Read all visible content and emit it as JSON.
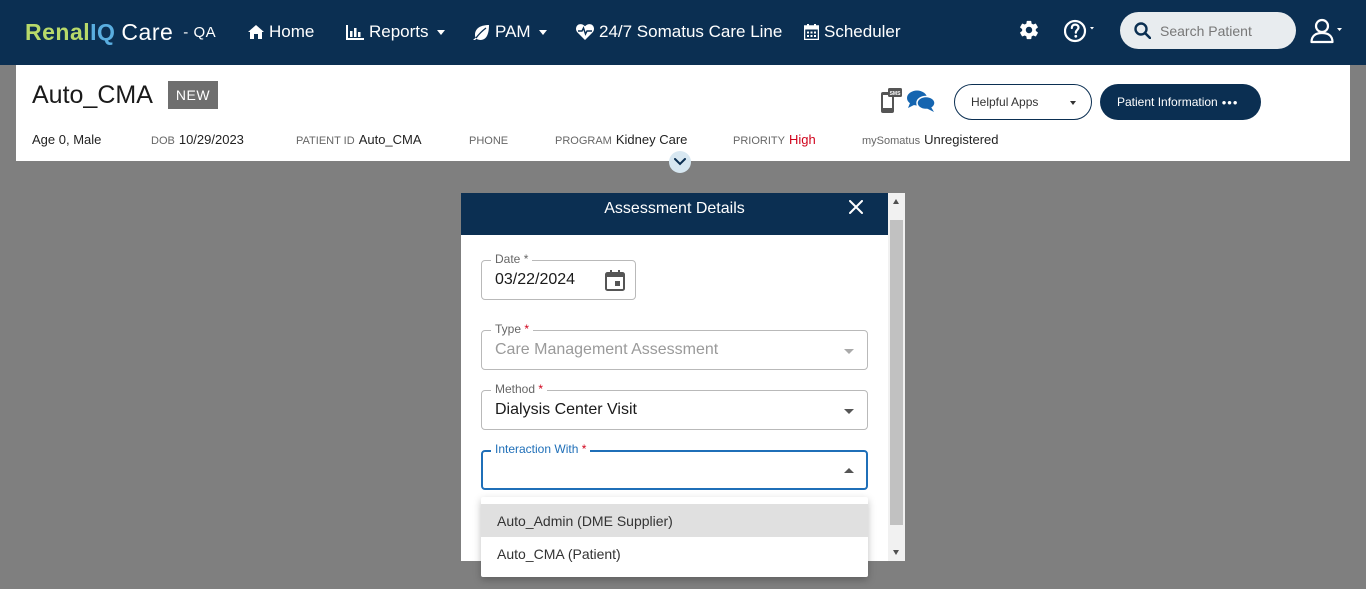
{
  "nav": {
    "brand_renal": "Renal",
    "brand_iq": "IQ",
    "brand_care": "Care",
    "env": "- QA",
    "home": "Home",
    "reports": "Reports",
    "pam": "PAM",
    "care_line": "24/7 Somatus Care Line",
    "scheduler": "Scheduler",
    "search_placeholder": "Search Patient"
  },
  "patient": {
    "name": "Auto_CMA",
    "badge": "NEW",
    "age_sex": "Age 0, Male",
    "dob_label": "DOB",
    "dob": "10/29/2023",
    "pid_label": "PATIENT ID",
    "pid": "Auto_CMA",
    "phone_label": "PHONE",
    "phone": "",
    "program_label": "PROGRAM",
    "program": "Kidney Care",
    "priority_label": "PRIORITY",
    "priority": "High",
    "mysomatus_label": "mySomatus",
    "mysomatus": "Unregistered",
    "helpful_apps": "Helpful Apps",
    "patient_info": "Patient Information",
    "more": "•••",
    "sms_icon_text": "SMS"
  },
  "modal": {
    "title": "Assessment Details",
    "date": {
      "label": "Date",
      "required": "*",
      "value": "03/22/2024"
    },
    "type": {
      "label": "Type",
      "required": "*",
      "value": "Care Management Assessment"
    },
    "method": {
      "label": "Method",
      "required": "*",
      "value": "Dialysis Center Visit"
    },
    "interaction": {
      "label": "Interaction With",
      "required": "*",
      "value": ""
    }
  },
  "menu": {
    "options": [
      "Auto_Admin (DME Supplier)",
      "Auto_CMA (Patient)"
    ],
    "highlighted_index": 0
  },
  "colors": {
    "nav_bg": "#0b2f52",
    "brand_green": "#b7d96a",
    "brand_blue": "#5aaee0",
    "priority_red": "#d0021b",
    "focus_blue": "#1f6fb8",
    "overlay": "#7f7f7f"
  }
}
